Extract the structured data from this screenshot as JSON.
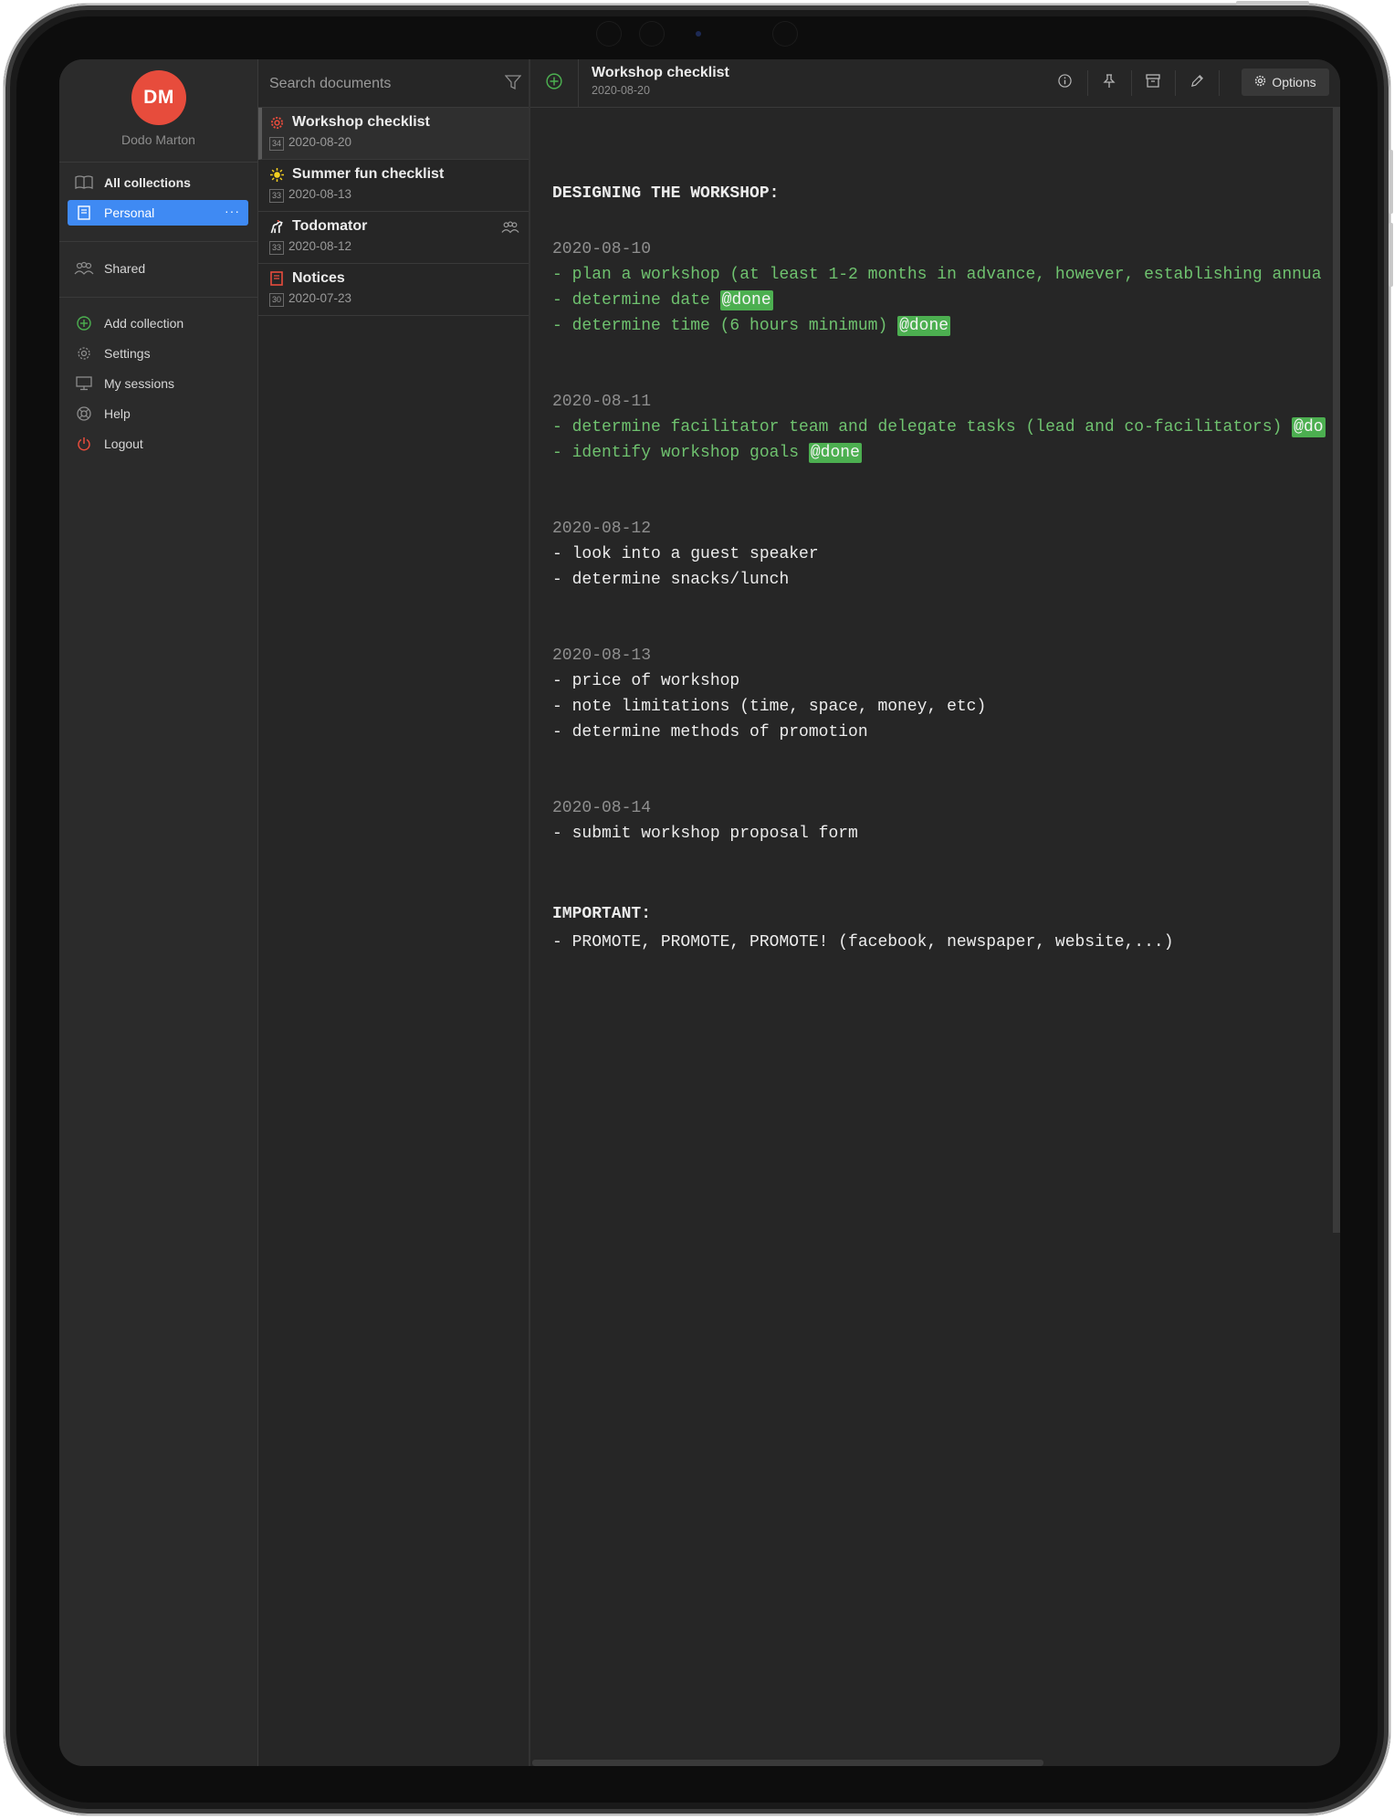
{
  "sidebar": {
    "avatar_initials": "DM",
    "user_name": "Dodo Marton",
    "items": [
      {
        "label": "All collections",
        "icon": "book-open-icon"
      },
      {
        "label": "Personal",
        "icon": "notebook-icon",
        "more": "···"
      },
      {
        "label": "Shared",
        "icon": "people-icon"
      },
      {
        "label": "Add collection",
        "icon": "plus-circle-icon"
      },
      {
        "label": "Settings",
        "icon": "gear-icon"
      },
      {
        "label": "My sessions",
        "icon": "monitor-icon"
      },
      {
        "label": "Help",
        "icon": "lifebuoy-icon"
      },
      {
        "label": "Logout",
        "icon": "power-icon"
      }
    ]
  },
  "search": {
    "placeholder": "Search documents"
  },
  "documents": [
    {
      "title": "Workshop checklist",
      "count": "34",
      "date": "2020-08-20",
      "icon": "gear-red-icon"
    },
    {
      "title": "Summer fun checklist",
      "count": "33",
      "date": "2020-08-13",
      "icon": "sun-icon"
    },
    {
      "title": "Todomator",
      "count": "33",
      "date": "2020-08-12",
      "icon": "horse-icon",
      "shared": true
    },
    {
      "title": "Notices",
      "count": "30",
      "date": "2020-07-23",
      "icon": "notebook-red-icon"
    }
  ],
  "header": {
    "title": "Workshop checklist",
    "date": "2020-08-20",
    "options_label": "Options"
  },
  "editor": {
    "heading": "DESIGNING THE WORKSHOP:",
    "lines": [
      {
        "text": "2020-08-10"
      },
      {
        "text": "- plan a workshop (at least 1-2 months in advance, however, establishing annua"
      },
      {
        "text": "- determine date ",
        "tag": "@done"
      },
      {
        "text": "- determine time (6 hours minimum) ",
        "tag": "@done"
      },
      {
        "text": "2020-08-11"
      },
      {
        "text": "- determine facilitator team and delegate tasks (lead and co-facilitators) ",
        "tag": "@do"
      },
      {
        "text": "- identify workshop goals ",
        "tag": "@done"
      },
      {
        "text": "2020-08-12"
      },
      {
        "text": "- look into a guest speaker"
      },
      {
        "text": "- determine snacks/lunch"
      },
      {
        "text": "2020-08-13"
      },
      {
        "text": "- price of workshop"
      },
      {
        "text": "- note limitations (time, space, money, etc)"
      },
      {
        "text": "- determine methods of promotion"
      },
      {
        "text": "2020-08-14"
      },
      {
        "text": "- submit workshop proposal form"
      }
    ],
    "important_heading": "IMPORTANT:",
    "important_line": "- PROMOTE, PROMOTE, PROMOTE! (facebook, newspaper, website,...)"
  },
  "colors": {
    "accent": "#3f8af3",
    "avatar": "#e74c3c",
    "done_text": "#6fc26f",
    "done_tag": "#4caf50"
  }
}
